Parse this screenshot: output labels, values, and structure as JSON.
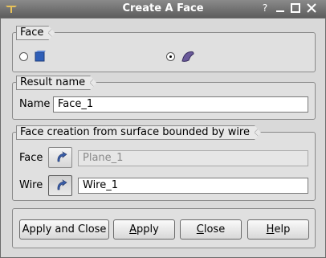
{
  "window": {
    "title": "Create A Face",
    "help_glyph": "?",
    "minimize_glyph": "—",
    "maximize_glyph": "☐",
    "close_glyph": "✕"
  },
  "face_group": {
    "label": "Face",
    "options": [
      {
        "icon": "box-icon",
        "checked": false
      },
      {
        "icon": "surface-icon",
        "checked": true
      }
    ]
  },
  "result_group": {
    "label": "Result name",
    "name_label": "Name",
    "name_value": "Face_1"
  },
  "wire_group": {
    "label": "Face creation from surface bounded by wire",
    "face_label": "Face",
    "face_value": "Plane_1",
    "wire_label": "Wire",
    "wire_value": "Wire_1"
  },
  "buttons": {
    "apply_close": "Apply and Close",
    "apply_prefix": "",
    "apply_mnemonic": "A",
    "apply_suffix": "pply",
    "close_prefix": "",
    "close_mnemonic": "C",
    "close_suffix": "lose",
    "help_prefix": "",
    "help_mnemonic": "H",
    "help_suffix": "elp"
  },
  "colors": {
    "titlebar": "#6e6e6e",
    "background": "#d9d9d9",
    "accent_icon": "#3a5ea8"
  }
}
